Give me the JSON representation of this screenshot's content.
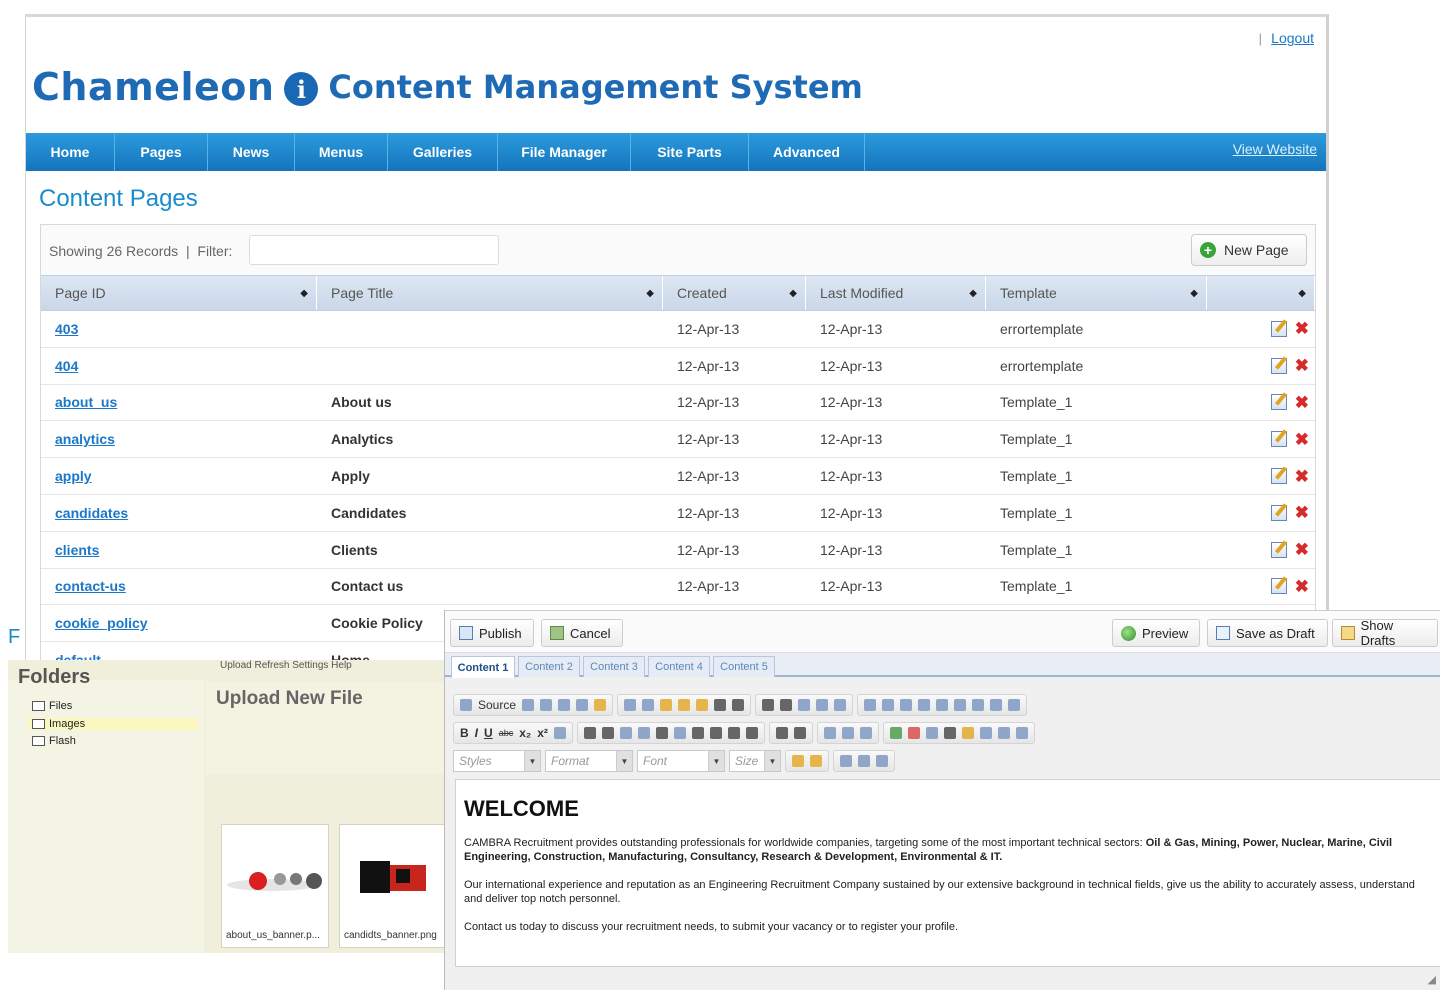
{
  "header": {
    "logout": "Logout",
    "brand": "Chameleon",
    "info_glyph": "i",
    "subtitle": "Content Management System"
  },
  "nav": {
    "items": [
      "Home",
      "Pages",
      "News",
      "Menus",
      "Galleries",
      "File Manager",
      "Site Parts",
      "Advanced"
    ],
    "view_website": "View Website"
  },
  "page": {
    "heading": "Content Pages",
    "showing": "Showing 26 Records",
    "filter_label": "Filter:",
    "filter_value": "",
    "new_page": "New Page"
  },
  "table": {
    "columns": [
      "Page ID",
      "Page Title",
      "Created",
      "Last Modified",
      "Template",
      ""
    ],
    "rows": [
      {
        "id": "403",
        "title": "",
        "created": "12-Apr-13",
        "modified": "12-Apr-13",
        "template": "errortemplate"
      },
      {
        "id": "404",
        "title": "",
        "created": "12-Apr-13",
        "modified": "12-Apr-13",
        "template": "errortemplate"
      },
      {
        "id": "about_us",
        "title": "About us",
        "created": "12-Apr-13",
        "modified": "12-Apr-13",
        "template": "Template_1"
      },
      {
        "id": "analytics",
        "title": "Analytics",
        "created": "12-Apr-13",
        "modified": "12-Apr-13",
        "template": "Template_1"
      },
      {
        "id": "apply",
        "title": "Apply",
        "created": "12-Apr-13",
        "modified": "12-Apr-13",
        "template": "Template_1"
      },
      {
        "id": "candidates",
        "title": "Candidates",
        "created": "12-Apr-13",
        "modified": "12-Apr-13",
        "template": "Template_1"
      },
      {
        "id": "clients",
        "title": "Clients",
        "created": "12-Apr-13",
        "modified": "12-Apr-13",
        "template": "Template_1"
      },
      {
        "id": "contact-us",
        "title": "Contact us",
        "created": "12-Apr-13",
        "modified": "12-Apr-13",
        "template": "Template_1"
      },
      {
        "id": "cookie_policy",
        "title": "Cookie Policy",
        "created": "",
        "modified": "",
        "template": ""
      },
      {
        "id": "default",
        "title": "Home",
        "created": "",
        "modified": "",
        "template": ""
      }
    ]
  },
  "file_manager": {
    "letter": "F",
    "folders_title": "Folders",
    "toolbar": "Upload   Refresh   Settings   Help",
    "folders": [
      "Files",
      "Images",
      "Flash"
    ],
    "upload_title": "Upload New File",
    "thumbs": [
      "about_us_banner.p...",
      "candidts_banner.png"
    ]
  },
  "editor": {
    "buttons": {
      "publish": "Publish",
      "cancel": "Cancel",
      "preview": "Preview",
      "save_draft": "Save as Draft",
      "show_drafts": "Show Drafts"
    },
    "tabs": [
      "Content 1",
      "Content 2",
      "Content 3",
      "Content 4",
      "Content 5"
    ],
    "source": "Source",
    "combos": {
      "styles": "Styles",
      "format": "Format",
      "font": "Font",
      "size": "Size"
    },
    "content": {
      "heading": "WELCOME",
      "p1_text": "CAMBRA Recruitment provides outstanding professionals for worldwide companies, targeting some of the most important technical sectors: ",
      "p1_bold": "Oil & Gas, Mining, Power, Nuclear, Marine, Civil Engineering, Construction, Manufacturing, Consultancy, Research & Development, Environmental & IT.",
      "p2": "Our international experience and reputation as an Engineering Recruitment Company sustained by our extensive background in technical fields, give us the ability to accurately assess, understand and deliver top notch personnel.",
      "p3": "Contact us today to discuss your recruitment needs, to submit your vacancy or to register your profile."
    }
  },
  "colors": {
    "brand": "#1f6ab5",
    "nav": "#1a83cc",
    "link": "#1a77c9",
    "delete": "#d62b2b"
  },
  "icons": [
    "info-icon",
    "plus-icon",
    "sort-icon",
    "edit-icon",
    "delete-icon",
    "folder-icon",
    "publish-icon",
    "cancel-icon",
    "preview-icon",
    "save-icon",
    "drafts-icon"
  ]
}
